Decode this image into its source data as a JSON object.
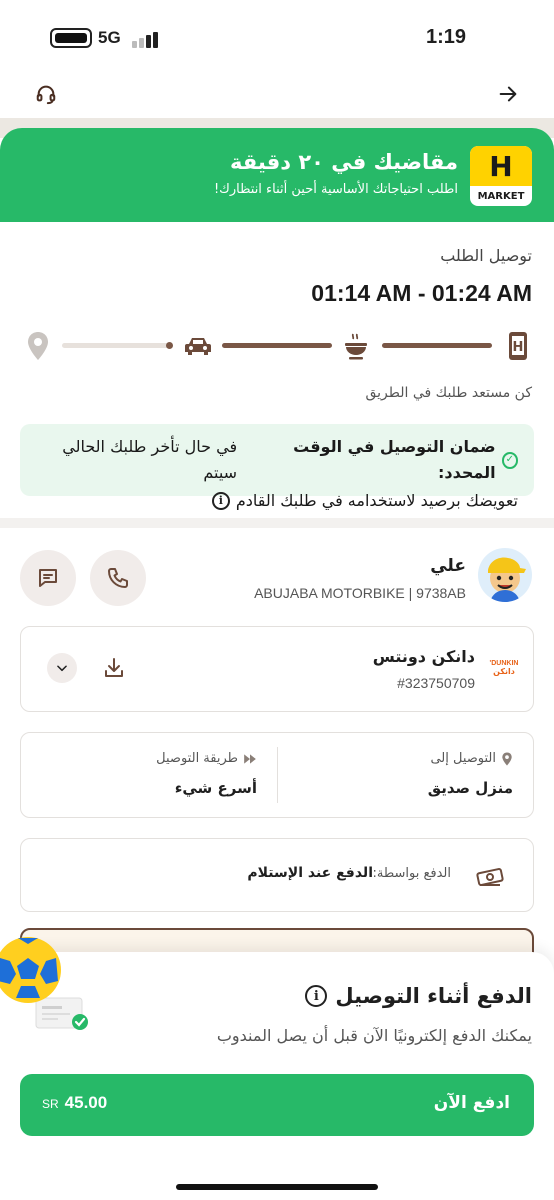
{
  "status_bar": {
    "network": "5G",
    "time": "1:19"
  },
  "banner": {
    "logo_letter": "H",
    "logo_text": "MARKET",
    "title": "مقاضيك في ٢٠ دقيقة",
    "subtitle": "اطلب احتياجاتك الأساسية أحين أثناء انتظارك!"
  },
  "delivery": {
    "label": "توصيل الطلب",
    "time_window": "01:14 AM - 01:24 AM",
    "status": "كن مستعد طلبك في الطريق",
    "guarantee_bold": "ضمان التوصيل في الوقت المحدد:",
    "guarantee_text": "في حال تأخر طلبك الحالي سيتم",
    "guarantee_text_2": "تعويضك برصيد لاستخدامه في طلبك القادم"
  },
  "driver": {
    "name": "علي",
    "vehicle": "ABUJABA MOTORBIKE | 9738AB"
  },
  "store": {
    "name": "دانكن دونتس",
    "order_number": "#323750709",
    "logo_text_top": "DUNKIN'",
    "logo_text_bottom": "دانكن"
  },
  "delivery_info": {
    "to_label": "التوصيل إلى",
    "to_value": "منزل صديق",
    "method_label": "طريقة التوصيل",
    "method_value": "أسرع شيء"
  },
  "payment": {
    "label": "الدفع بواسطة:",
    "value": "الدفع عند الإستلام"
  },
  "sheet": {
    "title": "الدفع أثناء التوصيل",
    "subtitle": "يمكنك الدفع إلكترونيًا الآن قبل أن يصل المندوب",
    "button_label": "ادفع الآن",
    "amount": "45.00",
    "currency": "SR"
  },
  "colors": {
    "brand_green": "#27b968",
    "accent_brown": "#6b4a3a",
    "track_done": "#7a5746",
    "track_pending": "#e7e1dc"
  },
  "icons": [
    "headset-icon",
    "arrow-right-icon",
    "phone-icon",
    "chat-icon",
    "download-icon",
    "chevron-down-icon",
    "location-pin-icon",
    "fast-forward-icon",
    "cash-icon",
    "info-icon",
    "check-circle-icon",
    "car-icon",
    "food-bowl-icon",
    "phone-h-icon"
  ]
}
